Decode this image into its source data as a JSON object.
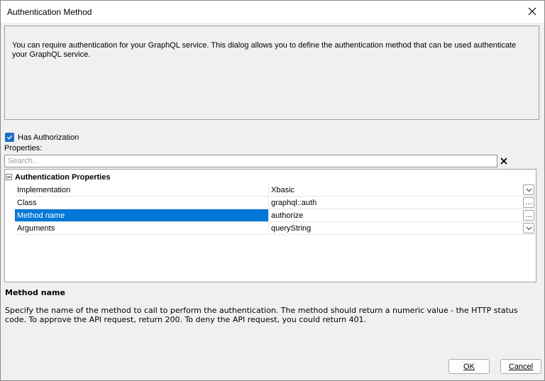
{
  "window": {
    "title": "Authentication Method"
  },
  "intro": {
    "text": "You can require authentication for your GraphQL service. This dialog allows you to define the authentication method that can be used authenticate your GraphQL service."
  },
  "authorization": {
    "label": "Has Authorization",
    "checked": true
  },
  "properties": {
    "label": "Properties:",
    "search_placeholder": "Search...",
    "group_title": "Authentication Properties",
    "rows": [
      {
        "name": "Implementation",
        "value": "Xbasic",
        "button": "dropdown"
      },
      {
        "name": "Class",
        "value": "graphql::auth",
        "button": "ellipsis"
      },
      {
        "name": "Method name",
        "value": "authorize",
        "button": "ellipsis",
        "selected": true
      },
      {
        "name": "Arguments",
        "value": "queryString",
        "button": "dropdown"
      }
    ]
  },
  "help": {
    "title": "Method name",
    "text": "Specify the name of the method to call to perform the authentication. The method should return a numeric value - the HTTP status code. To approve the API request, return 200. To deny the API request, you could return 401."
  },
  "buttons": {
    "ok": "OK",
    "cancel": "Cancel"
  },
  "colors": {
    "accent": "#0078d7",
    "checkbox": "#1a6fc4"
  }
}
